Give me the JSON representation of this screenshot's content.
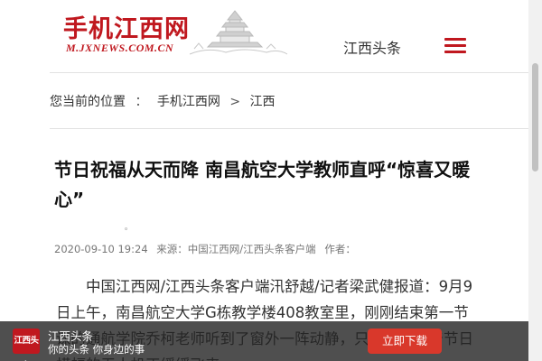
{
  "header": {
    "logo_title": "手机江西网",
    "logo_subtitle": "M.JXNEWS.COM.CN",
    "channel_label": "江西头条",
    "menu_icon": "hamburger-menu-icon"
  },
  "breadcrumb": {
    "prefix": "您当前的位置",
    "colon": "：",
    "items": [
      "手机江西网",
      "江西"
    ],
    "separator": ">"
  },
  "article": {
    "title": "节日祝福从天而降 南昌航空大学教师直呼“惊喜又暖心”",
    "tiny_mark": "。",
    "datetime": "2020-09-10 19:24",
    "source": "来源：中国江西网/江西头条客户端",
    "author": "作者：",
    "body": "中国江西网/江西头条客户端汛舒越/记者梁武健报道：9月9日上午，南昌航空大学G栋教学楼408教室里，刚刚结束第一节课的通航学院乔柯老师听到了窗外一阵动静，只见一架带着节日横幅的无人机正缓缓飞来，…"
  },
  "banner": {
    "app_icon_text": "江西头条",
    "app_name": "江西头条",
    "app_slogan": "你的头条 你身边的事",
    "download_label": "立即下载",
    "button_color": "#d9382b"
  },
  "colors": {
    "brand": "#c0181f",
    "text": "#333333",
    "meta": "#777777"
  }
}
